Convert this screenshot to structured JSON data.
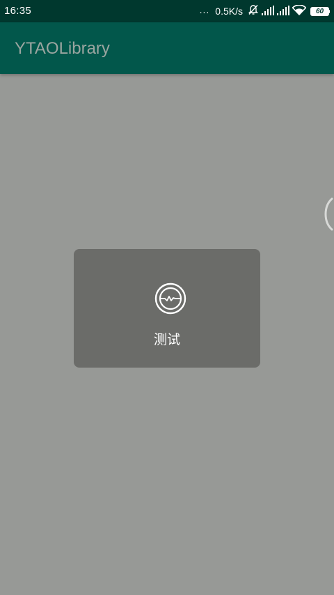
{
  "status_bar": {
    "time": "16:35",
    "more_dots": "...",
    "network_speed": "0.5K/s",
    "battery_level": "60",
    "icons": [
      "mute-bell-icon",
      "signal-icon",
      "signal-icon",
      "wifi-icon",
      "battery-icon"
    ]
  },
  "app_bar": {
    "title": "YTAOLibrary"
  },
  "toast": {
    "icon": "pulse-circle-icon",
    "text": "测试"
  },
  "edge_handle": {
    "icon": "edge-handle-icon"
  },
  "colors": {
    "status_bar": "#00382e",
    "app_bar": "#02574b",
    "title_text": "#9aa5a0",
    "background_dimmed": "#979996",
    "toast_bg": "#6b6c69"
  }
}
